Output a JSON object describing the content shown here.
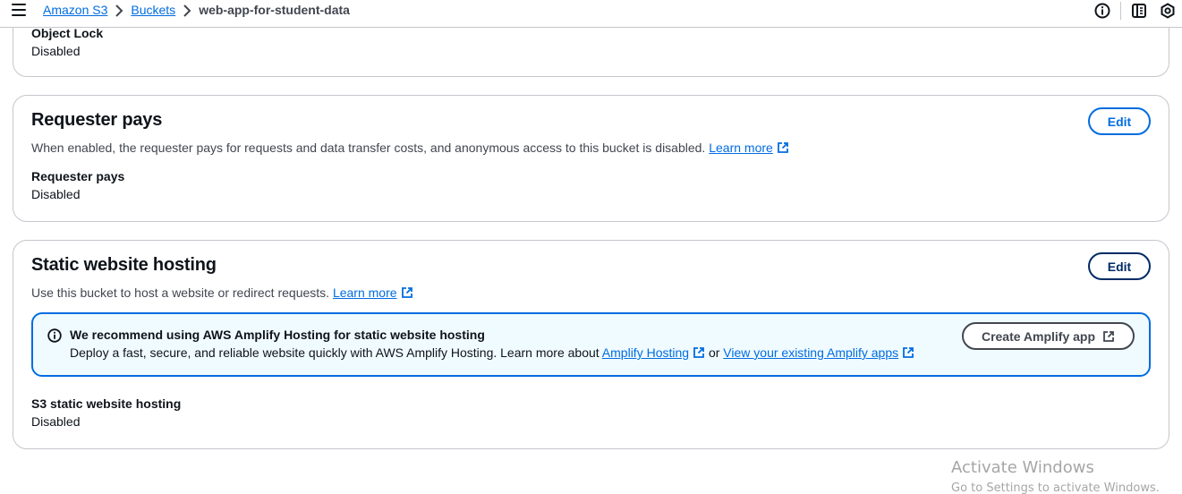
{
  "breadcrumb": {
    "items": [
      "Amazon S3",
      "Buckets"
    ],
    "current": "web-app-for-student-data"
  },
  "header_icons": [
    "info-circle-icon",
    "notifications-panel-icon",
    "settings-hexagon-icon"
  ],
  "object_lock": {
    "label": "Object Lock",
    "value": "Disabled"
  },
  "requester_pays": {
    "title": "Requester pays",
    "description": "When enabled, the requester pays for requests and data transfer costs, and anonymous access to this bucket is disabled.",
    "learn_more": "Learn more",
    "edit_label": "Edit",
    "field_label": "Requester pays",
    "field_value": "Disabled"
  },
  "static_hosting": {
    "title": "Static website hosting",
    "description": "Use this bucket to host a website or redirect requests.",
    "learn_more": "Learn more",
    "edit_label": "Edit",
    "alert": {
      "title": "We recommend using AWS Amplify Hosting for static website hosting",
      "body_prefix": "Deploy a fast, secure, and reliable website quickly with AWS Amplify Hosting. Learn more about",
      "link_amplify": "Amplify Hosting",
      "or_text": "or",
      "link_existing": "View your existing Amplify apps",
      "button_label": "Create Amplify app"
    },
    "field_label": "S3 static website hosting",
    "field_value": "Disabled"
  },
  "watermark": {
    "title": "Activate Windows",
    "subtitle": "Go to Settings to activate Windows."
  },
  "colors": {
    "link": "#006ce0",
    "edit_dark": "#002b66",
    "alert_bg": "#f0fbff",
    "border": "#c6c6cd"
  }
}
